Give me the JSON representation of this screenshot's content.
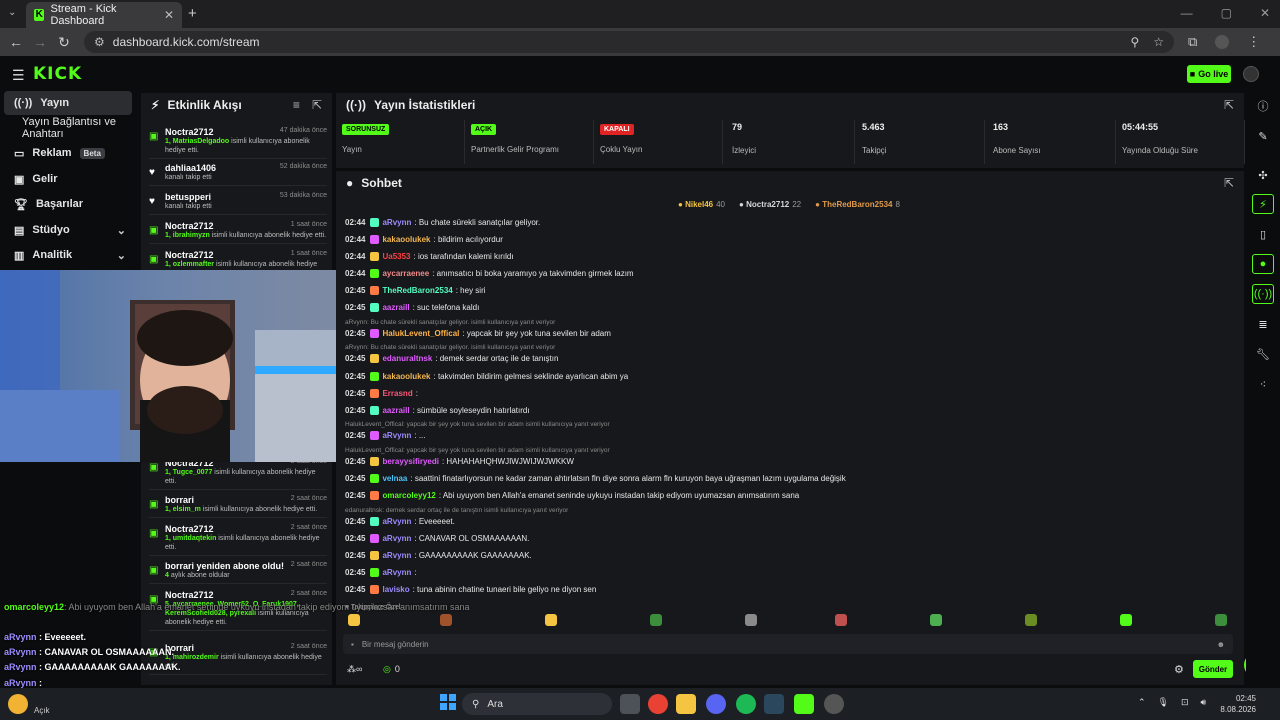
{
  "browser": {
    "tab_title": "Stream - Kick Dashboard",
    "url": "dashboard.kick.com/stream"
  },
  "header": {
    "logo": "KICK",
    "go_live": "Go live"
  },
  "sidebar": {
    "items": [
      {
        "label": "Yayın"
      },
      {
        "label": "Yayın Bağlantısı ve Anahtarı"
      },
      {
        "label": "Reklam",
        "badge": "Beta"
      },
      {
        "label": "Gelir"
      },
      {
        "label": "Başarılar"
      },
      {
        "label": "Stüdyo"
      },
      {
        "label": "Analitik"
      }
    ]
  },
  "activity": {
    "title": "Etkinlik Akışı",
    "items": [
      {
        "name": "Noctra2712",
        "time": "47 dakika önce",
        "desc_name": "1, MatriasDelgadoo",
        "desc": "isimli kullanıcıya abonelik hediye etti."
      },
      {
        "name": "dahliaa1406",
        "time": "52 dakika önce",
        "desc_name": "",
        "desc": "kanalı takip etti"
      },
      {
        "name": "betuspperi",
        "time": "53 dakika önce",
        "desc_name": "",
        "desc": "kanalı takip etti"
      },
      {
        "name": "Noctra2712",
        "time": "1 saat önce",
        "desc_name": "1, ibrahimyzn",
        "desc": "isimli kullanıcıya abonelik hediye etti."
      },
      {
        "name": "Noctra2712",
        "time": "1 saat önce",
        "desc_name": "1, ozlemmafter",
        "desc": "isimli kullanıcıya abonelik hediye"
      },
      {
        "name": "Noctra2712",
        "time": "2 saat önce",
        "desc_name": "1, Tugce_0077",
        "desc": "isimli kullanıcıya abonelik hediye etti."
      },
      {
        "name": "borrari",
        "time": "2 saat önce",
        "desc_name": "1, elsim_m",
        "desc": "isimli kullanıcıya abonelik hediye etti."
      },
      {
        "name": "Noctra2712",
        "time": "2 saat önce",
        "desc_name": "1, umitdaqtekin",
        "desc": "isimli kullanıcıya abonelik hediye etti."
      },
      {
        "name": "borrari yeniden abone oldu!",
        "time": "2 saat önce",
        "desc_name": "4",
        "desc": "aylık abone oldular"
      },
      {
        "name": "Noctra2712",
        "time": "2 saat önce",
        "desc_name": "5, aycarraenee, Womer52_O_Faruk1907, KeremScofield028, pyrexali",
        "desc": "isimli kullanıcıya abonelik hediye etti."
      },
      {
        "name": "borrari",
        "time": "2 saat önce",
        "desc_name": "1, mahirozdemir",
        "desc": "isimli kullanıcıya abonelik hediye etti."
      }
    ]
  },
  "stats": {
    "title": "Yayın İstatistikleri",
    "items": [
      {
        "badge": "SORUNSUZ",
        "badge_color": "#53fc18",
        "value": "",
        "label": "Yayın"
      },
      {
        "badge": "AÇIK",
        "badge_color": "#53fc18",
        "value": "",
        "label": "Partnerlik Gelir Programı"
      },
      {
        "badge": "KAPALI",
        "badge_color": "#e02424",
        "value": "",
        "label": "Çoklu Yayın"
      },
      {
        "badge": "",
        "value": "79",
        "label": "İzleyici"
      },
      {
        "badge": "",
        "value": "5.463",
        "label": "Takipçi"
      },
      {
        "badge": "",
        "value": "163",
        "label": "Abone Sayısı"
      },
      {
        "badge": "",
        "value": "05:44:55",
        "label": "Yayında Olduğu Süre"
      }
    ]
  },
  "chat": {
    "title": "Sohbet",
    "top_chatters": [
      {
        "name": "Nikel46",
        "count": "40",
        "color": "#f5c542"
      },
      {
        "name": "Noctra2712",
        "count": "22",
        "color": "#d8d8d8"
      },
      {
        "name": "TheRedBaron2534",
        "count": "8",
        "color": "#e09a4a"
      }
    ],
    "messages": [
      {
        "time": "02:44",
        "user": "aRvynn",
        "color": "#9b8cff",
        "text": ": Bu chate sürekli sanatçılar geliyor."
      },
      {
        "time": "02:44",
        "user": "kakaoolukek",
        "color": "#f3b64e",
        "text": ": bildirim acılıyordur"
      },
      {
        "time": "02:44",
        "user": "Ua5353",
        "color": "#ff4040",
        "text": ": ios tarafından kalemi kırıldı"
      },
      {
        "time": "02:44",
        "user": "aycarraenee",
        "color": "#f08a8a",
        "text": ": anımsatıcı bi boka yaramıyo ya takvimden girmek lazım"
      },
      {
        "time": "02:45",
        "user": "TheRedBaron2534",
        "color": "#53fcc0",
        "text": ": hey siri"
      },
      {
        "time": "02:45",
        "user": "aazraill",
        "color": "#e05bff",
        "text": ": suc telefona kaldı"
      },
      {
        "time": "02:45",
        "user": "HalukLevent_Offical",
        "color": "#ffb347",
        "text": ": yapcak bir şey yok tuna sevilen bir adam",
        "reply": "aRvynn: Bu chate sürekli sanatçılar geliyor. isimli kullanıcıya yanıt veriyor"
      },
      {
        "time": "02:45",
        "user": "edanuraltnsk",
        "color": "#e05bff",
        "text": ": demek serdar ortaç ile de tanıştın",
        "reply": "aRvynn: Bu chate sürekli sanatçılar geliyor. isimli kullanıcıya yanıt veriyor"
      },
      {
        "time": "02:45",
        "user": "kakaoolukek",
        "color": "#f3b64e",
        "text": ": takvimden bildirim gelmesi seklinde ayarlıcan abim ya"
      },
      {
        "time": "02:45",
        "user": "Errasnd",
        "color": "#ff5577",
        "text": ":"
      },
      {
        "time": "02:45",
        "user": "aazraill",
        "color": "#e05bff",
        "text": ": sümbüle soyleseydin hatırlatırdı"
      },
      {
        "time": "02:45",
        "user": "aRvynn",
        "color": "#9b8cff",
        "text": ": ...",
        "reply": "HalukLevent_Offical: yapcak bir şey yok tuna sevilen bir adam isimli kullanıcıya yanıt veriyor"
      },
      {
        "time": "02:45",
        "user": "berayysifiryedi",
        "color": "#e05bff",
        "text": ": HAHAHAHQHWJIWJWIJWJWKKW",
        "reply": "HalukLevent_Offical: yapcak bir şey yok tuna sevilen bir adam isimli kullanıcıya yanıt veriyor"
      },
      {
        "time": "02:45",
        "user": "velnaa",
        "color": "#4fc3f7",
        "text": ": saattini finatarlıyorsun ne kadar zaman ahtırlatsın fln diye sonra alarm fln kuruyon baya uğraşman lazım uygulama değişik"
      },
      {
        "time": "02:45",
        "user": "omarcoleyy12",
        "color": "#53fc18",
        "text": ": Abi uyuyom ben Allah'a emanet seninde uykuyu instadan takip ediyom uyumazsan anımsatırım sana"
      },
      {
        "time": "02:45",
        "user": "aRvynn",
        "color": "#9b8cff",
        "text": ": Eveeeeet.",
        "reply": "edanuraltnsk: demek serdar ortaç ile de tanıştın isimli kullanıcıya yanıt veriyor"
      },
      {
        "time": "02:45",
        "user": "aRvynn",
        "color": "#9b8cff",
        "text": ": CANAVAR OL OSMAAAAAAN."
      },
      {
        "time": "02:45",
        "user": "aRvynn",
        "color": "#9b8cff",
        "text": ": GAAAAAAAAAK GAAAAAAAK."
      },
      {
        "time": "02:45",
        "user": "aRvynn",
        "color": "#9b8cff",
        "text": ":"
      },
      {
        "time": "02:45",
        "user": "lavisko",
        "color": "#9b8cff",
        "text": ": tuna abinin chatine tunaeri bile geliyo ne diyon sen"
      }
    ],
    "followers_only": "Takipçilere Özel",
    "input_placeholder": "Bir mesaj gönderin",
    "send": "Gönder",
    "points": "0"
  },
  "overlay": {
    "lines": [
      {
        "user": "omarcoleyy12",
        "text": ": Abi uyuyom ben Allah'a emanet seninde uykuyu instadan takip ediyom uyumazsan anımsatırım sana"
      },
      {
        "user": "aRvynn",
        "text": " : Eveeeeet."
      },
      {
        "user": "aRvynn",
        "text": " : CANAVAR OL OSMAAAAAAN."
      },
      {
        "user": "aRvynn",
        "text": " : GAAAAAAAAAK GAAAAAAAK."
      },
      {
        "user": "aRvynn",
        "text": " :"
      },
      {
        "user": "lavisko",
        "text": " : tuna abinin chatine tunaeri bile geliyo ne diyon sen"
      }
    ]
  },
  "taskbar": {
    "weather": "Açık",
    "search": "Ara",
    "time": "02:45",
    "date": "8.08.2026"
  }
}
